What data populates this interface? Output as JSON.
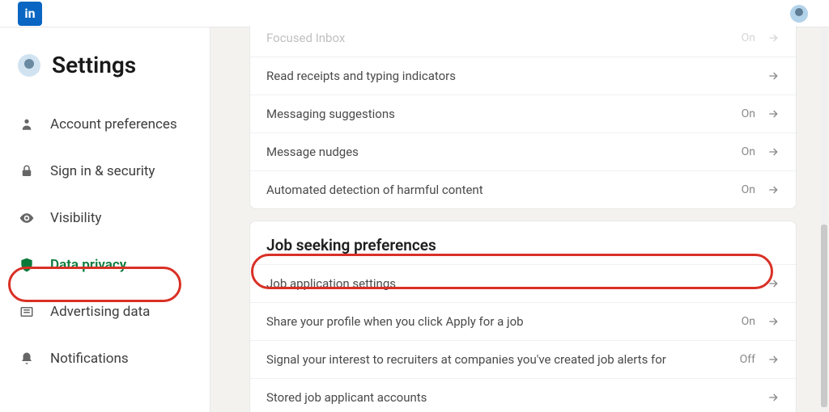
{
  "topbar": {
    "logo_text": "in"
  },
  "sidebar": {
    "title": "Settings",
    "items": [
      {
        "label": "Account preferences",
        "active": false
      },
      {
        "label": "Sign in & security",
        "active": false
      },
      {
        "label": "Visibility",
        "active": false
      },
      {
        "label": "Data privacy",
        "active": true
      },
      {
        "label": "Advertising data",
        "active": false
      },
      {
        "label": "Notifications",
        "active": false
      }
    ]
  },
  "main": {
    "section_partial": {
      "rows": [
        {
          "label": "Focused Inbox",
          "status": "On"
        },
        {
          "label": "Read receipts and typing indicators",
          "status": ""
        },
        {
          "label": "Messaging suggestions",
          "status": "On"
        },
        {
          "label": "Message nudges",
          "status": "On"
        },
        {
          "label": "Automated detection of harmful content",
          "status": "On"
        }
      ]
    },
    "section_job": {
      "title": "Job seeking preferences",
      "rows": [
        {
          "label": "Job application settings",
          "status": ""
        },
        {
          "label": "Share your profile when you click Apply for a job",
          "status": "On"
        },
        {
          "label": "Signal your interest to recruiters at companies you've created job alerts for",
          "status": "Off"
        },
        {
          "label": "Stored job applicant accounts",
          "status": ""
        }
      ]
    }
  }
}
